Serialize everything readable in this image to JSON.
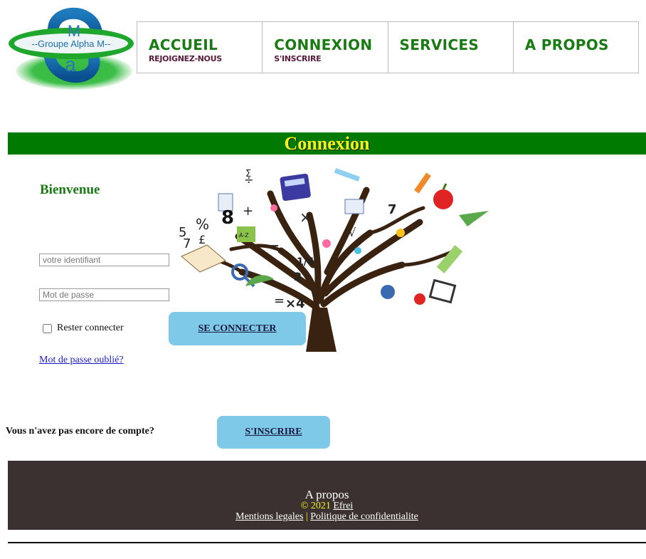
{
  "logo": {
    "text": "--Groupe Alpha M--",
    "letter_top": "M",
    "letter_bottom": "a"
  },
  "nav": [
    {
      "main": "ACCUEIL",
      "sub": "REJOIGNEZ-NOUS"
    },
    {
      "main": "CONNEXION",
      "sub": "S'INSCRIRE"
    },
    {
      "main": "SERVICES",
      "sub": ""
    },
    {
      "main": "A PROPOS",
      "sub": ""
    }
  ],
  "banner": {
    "title": "Connexion"
  },
  "login": {
    "welcome": "Bienvenue",
    "identifier_placeholder": "votre identifiant",
    "password_placeholder": "Mot de passe",
    "remember_label": "Rester connecter",
    "submit_label": "SE CONNECTER",
    "forgot_label": "Mot de passe oublié?"
  },
  "signup": {
    "prompt": "Vous n'avez pas encore de compte?",
    "button_label": "S'INSCRIRE"
  },
  "illustration": {
    "symbols": [
      "÷",
      "Σ",
      "8",
      "%",
      "5",
      "7",
      "£",
      "+",
      "×",
      "−",
      "1/4",
      "=",
      "×4",
      "2",
      "√",
      "7",
      "A-Z"
    ]
  },
  "footer": {
    "title": "A propos",
    "copyright_symbol": "©",
    "year": "2021",
    "org_link": "Efrei",
    "legal_link": "Mentions legales",
    "separator": "|",
    "privacy_link": "Politique de confidentialite"
  },
  "colors": {
    "brand_green": "#007a00",
    "title_yellow": "#f3f41a",
    "button_blue": "#7ec8e8",
    "footer_bg": "#3b3131"
  }
}
